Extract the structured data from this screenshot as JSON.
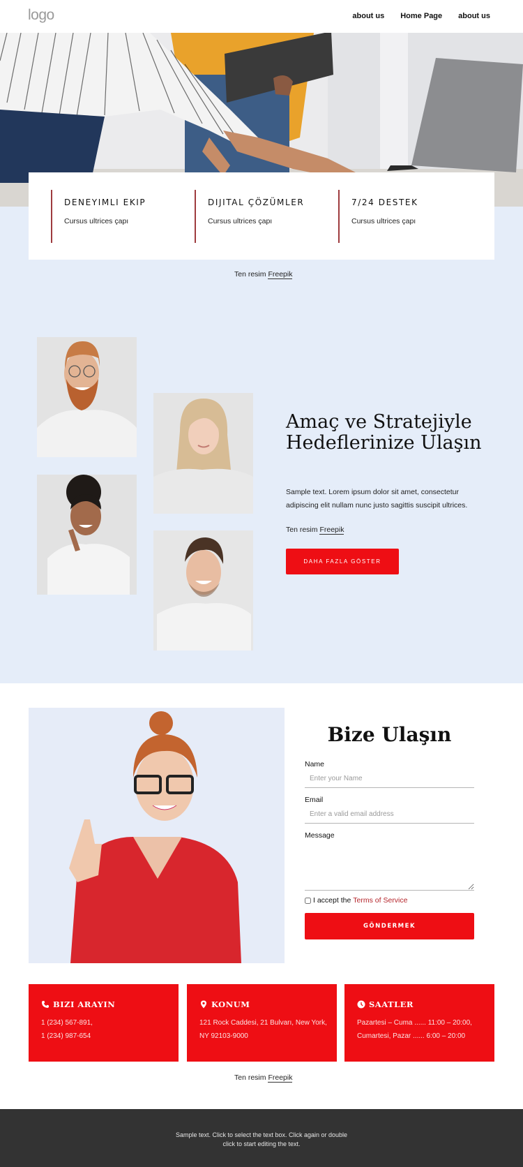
{
  "header": {
    "logo": "logo",
    "nav": [
      {
        "label": "about us"
      },
      {
        "label": "Home Page"
      },
      {
        "label": "about us"
      }
    ]
  },
  "hero": {
    "image": "team-working-at-laptop-photo"
  },
  "features": [
    {
      "title": "DENEYIMLI EKIP",
      "text": "Cursus ultrices çapı"
    },
    {
      "title": "DIJITAL ÇÖZÜMLER",
      "text": "Cursus ultrices çapı"
    },
    {
      "title": "7/24 DESTEK",
      "text": "Cursus ultrices çapı"
    }
  ],
  "credit": {
    "prefix": "Ten resim",
    "link": "Freepik"
  },
  "team": {
    "photos": [
      "bearded-man-glasses",
      "blonde-woman",
      "curly-hair-woman",
      "smiling-man"
    ],
    "headline": "Amaç ve Stratejiyle Hedeflerinize Ulaşın",
    "text": "Sample text. Lorem ipsum dolor sit amet, consectetur adipiscing elit nullam nunc justo sagittis suscipit ultrices.",
    "credit_prefix": "Ten resim",
    "credit_link": "Freepik",
    "button": "DAHA FAZLA GÖSTER"
  },
  "contact": {
    "title": "Bize Ulaşın",
    "name_label": "Name",
    "name_placeholder": "Enter your Name",
    "email_label": "Email",
    "email_placeholder": "Enter a valid email address",
    "message_label": "Message",
    "accept_prefix": "I accept the",
    "accept_link": "Terms of Service",
    "submit": "GÖNDERMEK"
  },
  "info_cards": [
    {
      "icon": "phone-icon",
      "title": "BIZI ARAYIN",
      "line1": "1 (234) 567-891,",
      "line2": "1 (234) 987-654"
    },
    {
      "icon": "location-pin-icon",
      "title": "KONUM",
      "line1": "121 Rock Caddesi, 21 Bulvarı, New York,",
      "line2": "NY 92103-9000"
    },
    {
      "icon": "clock-icon",
      "title": "SAATLER",
      "line1": "Pazartesi – Cuma ...... 11:00 – 20:00,",
      "line2": "Cumartesi, Pazar ...... 6:00 – 20:00"
    }
  ],
  "bottom_credit": {
    "prefix": "Ten resim",
    "link": "Freepik"
  },
  "footer": {
    "line1": "Sample text. Click to select the text box. Click again or double",
    "line2": "click to start editing the text."
  },
  "colors": {
    "accent": "#ee0e14",
    "divider": "#9e3b3e",
    "section_bg": "#e5edf9",
    "footer_bg": "#333333"
  }
}
